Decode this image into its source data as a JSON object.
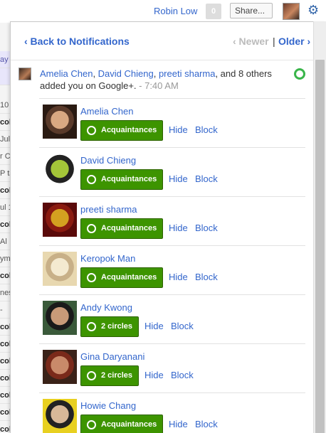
{
  "topbar": {
    "user_name": "Robin Low",
    "notification_count": "0",
    "share_label": "Share..."
  },
  "background_strip": [
    {
      "text": "ay",
      "style": "blue"
    },
    {
      "text": "",
      "style": "blue"
    },
    {
      "text": "10",
      "style": ""
    },
    {
      "text": "col",
      "style": "b"
    },
    {
      "text": "Jul",
      "style": ""
    },
    {
      "text": "r C",
      "style": ""
    },
    {
      "text": "P ta",
      "style": ""
    },
    {
      "text": "col",
      "style": "b"
    },
    {
      "text": "ul 1",
      "style": ""
    },
    {
      "text": "col",
      "style": "b"
    },
    {
      "text": "Al",
      "style": ""
    },
    {
      "text": "ym",
      "style": ""
    },
    {
      "text": "col",
      "style": "b"
    },
    {
      "text": "nes",
      "style": ""
    },
    {
      "text": " - ",
      "style": ""
    },
    {
      "text": "col",
      "style": "b"
    },
    {
      "text": "col",
      "style": "b"
    },
    {
      "text": "col",
      "style": "b"
    },
    {
      "text": "col",
      "style": "b"
    },
    {
      "text": "col",
      "style": "b"
    },
    {
      "text": "col",
      "style": "b"
    },
    {
      "text": "col",
      "style": "b"
    }
  ],
  "nav": {
    "back_label": "‹ Back to Notifications",
    "newer_label": "‹ Newer",
    "separator": "|",
    "older_label": "Older ›"
  },
  "summary": {
    "name1": "Amelia Chen",
    "comma1": ", ",
    "name2": "David Chieng",
    "comma2": ", ",
    "name3": "preeti sharma",
    "rest": ", and 8 others added you on Google+.",
    "time": " -  7:40 AM"
  },
  "people": [
    {
      "name": "Amelia Chen",
      "button": "Acquaintances",
      "hide": "Hide",
      "block": "Block",
      "photo_colors": [
        "#2a1a12",
        "#d9a882",
        "#5a3a2a"
      ]
    },
    {
      "name": "David Chieng",
      "button": "Acquaintances",
      "hide": "Hide",
      "block": "Block",
      "photo_colors": [
        "#ffffff",
        "#a4c639",
        "#222222"
      ]
    },
    {
      "name": "preeti sharma",
      "button": "Acquaintances",
      "hide": "Hide",
      "block": "Block",
      "photo_colors": [
        "#5a0a0a",
        "#d4a020",
        "#8a1a10"
      ]
    },
    {
      "name": "Keropok Man",
      "button": "Acquaintances",
      "hide": "Hide",
      "block": "Block",
      "photo_colors": [
        "#e8d8b0",
        "#f4ead0",
        "#c8b088"
      ]
    },
    {
      "name": "Andy Kwong",
      "button": "2 circles",
      "hide": "Hide",
      "block": "Block",
      "photo_colors": [
        "#3a5a3a",
        "#c89a78",
        "#1a1a1a"
      ]
    },
    {
      "name": "Gina Daryanani",
      "button": "2 circles",
      "hide": "Hide",
      "block": "Block",
      "photo_colors": [
        "#3a2218",
        "#c98a6a",
        "#7a2a1a"
      ]
    },
    {
      "name": "Howie Chang",
      "button": "Acquaintances",
      "hide": "Hide",
      "block": "Block",
      "photo_colors": [
        "#e8d020",
        "#d8b898",
        "#222222"
      ]
    }
  ],
  "colors": {
    "link": "#3366cc",
    "button_green": "#3d9400",
    "circle_green": "#39b54a"
  }
}
